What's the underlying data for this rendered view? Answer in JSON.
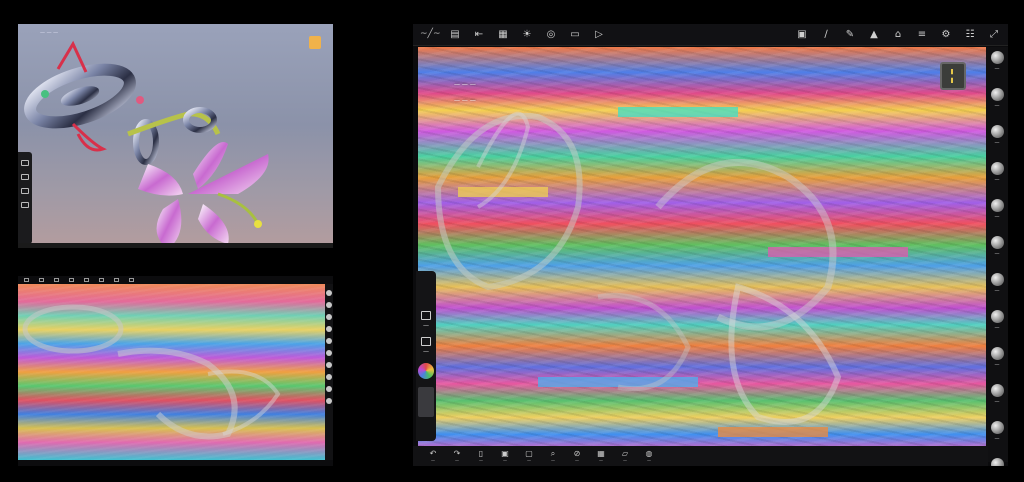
{
  "panel_a": {
    "info_text": "— — —",
    "left_tools": [
      "□",
      "○",
      "▣",
      "∕"
    ]
  },
  "panel_b": {
    "topbar_icons": 12
  },
  "main": {
    "brand": "~╱~",
    "top_icons": [
      {
        "name": "folder-icon",
        "glyph": "▤"
      },
      {
        "name": "share-icon",
        "glyph": "⇤"
      },
      {
        "name": "grid-icon",
        "glyph": "▦"
      },
      {
        "name": "sun-icon",
        "glyph": "☀"
      },
      {
        "name": "spiral-icon",
        "glyph": "◎"
      },
      {
        "name": "image-icon",
        "glyph": "▭"
      },
      {
        "name": "video-icon",
        "glyph": "▷"
      },
      {
        "name": "camera-icon",
        "glyph": "▣"
      },
      {
        "name": "pen-icon",
        "glyph": "∕"
      },
      {
        "name": "pencil-icon",
        "glyph": "✎"
      },
      {
        "name": "triangle-icon",
        "glyph": "▲"
      },
      {
        "name": "eraser-icon",
        "glyph": "⌂"
      },
      {
        "name": "layers-icon",
        "glyph": "≡"
      },
      {
        "name": "gear-icon",
        "glyph": "⚙"
      },
      {
        "name": "sliders-icon",
        "glyph": "☷"
      },
      {
        "name": "expand-icon",
        "glyph": "⤢"
      }
    ],
    "canvas_labels": [
      "— — —",
      "— — —"
    ],
    "left_tools": [
      {
        "glyph": "▣",
        "caption": "—"
      },
      {
        "glyph": "□",
        "caption": "—"
      }
    ],
    "right_tools": [
      {
        "caption": "—"
      },
      {
        "caption": "—"
      },
      {
        "caption": "—"
      },
      {
        "caption": "—"
      },
      {
        "caption": "—"
      },
      {
        "caption": "—"
      },
      {
        "caption": "—"
      },
      {
        "caption": "—"
      },
      {
        "caption": "—"
      },
      {
        "caption": "—"
      },
      {
        "caption": "—"
      },
      {
        "caption": "—"
      }
    ],
    "bottom_tools": [
      {
        "name": "undo-icon",
        "glyph": "↶",
        "caption": "—"
      },
      {
        "name": "redo-icon",
        "glyph": "↷",
        "caption": "—"
      },
      {
        "name": "device-icon",
        "glyph": "▯",
        "caption": "—"
      },
      {
        "name": "capture-icon",
        "glyph": "▣",
        "caption": "—"
      },
      {
        "name": "crop-icon",
        "glyph": "▢",
        "caption": "—"
      },
      {
        "name": "search-icon",
        "glyph": "⌕",
        "caption": "—"
      },
      {
        "name": "hide-icon",
        "glyph": "⊘",
        "caption": "—"
      },
      {
        "name": "grid-icon",
        "glyph": "▦",
        "caption": "—"
      },
      {
        "name": "export-icon",
        "glyph": "▱",
        "caption": "—"
      },
      {
        "name": "globe-icon",
        "glyph": "◍",
        "caption": "—"
      }
    ]
  }
}
